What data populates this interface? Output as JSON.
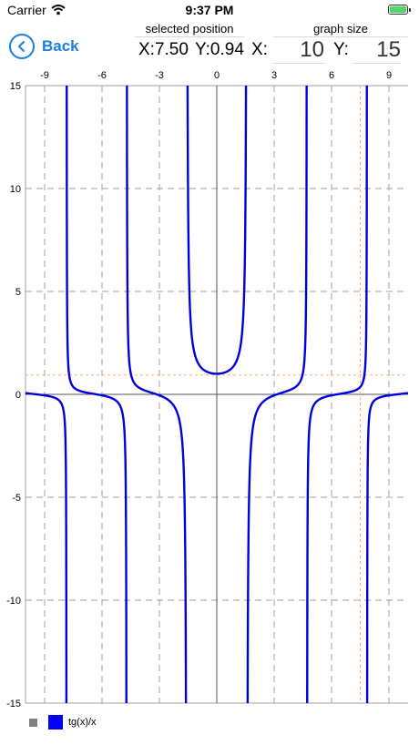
{
  "status_bar": {
    "carrier": "Carrier",
    "time": "9:37 PM"
  },
  "header": {
    "back_label": "Back",
    "selected_position_title": "selected position",
    "selected_x": "X:7.50",
    "selected_y": "Y:0.94",
    "graph_size_title": "graph size",
    "size_x_label": "X:",
    "size_x_value": "10",
    "size_y_label": "Y:",
    "size_y_value": "15"
  },
  "colors": {
    "accent": "#1a7fe0",
    "curve": "#0000e0",
    "crosshair": "#ffb060",
    "grid": "#a0a0a0",
    "battery": "#4cd964"
  },
  "icons": {
    "back": "chevron-left-circle-icon",
    "wifi": "wifi-icon",
    "battery": "battery-icon"
  },
  "legend": {
    "series_name": "tg(x)/x"
  },
  "chart_data": {
    "type": "line",
    "function": "tan(x)/x",
    "xlim": [
      -10,
      10
    ],
    "ylim": [
      -15,
      15
    ],
    "x_ticks": [
      -9,
      -6,
      -3,
      0,
      3,
      6,
      9
    ],
    "y_ticks": [
      -15,
      -10,
      -5,
      0,
      5,
      10,
      15
    ],
    "grid": true,
    "legend_position": "bottom-left",
    "selected_point": {
      "x": 7.5,
      "y": 0.94
    },
    "series": [
      {
        "name": "tg(x)/x"
      }
    ]
  }
}
